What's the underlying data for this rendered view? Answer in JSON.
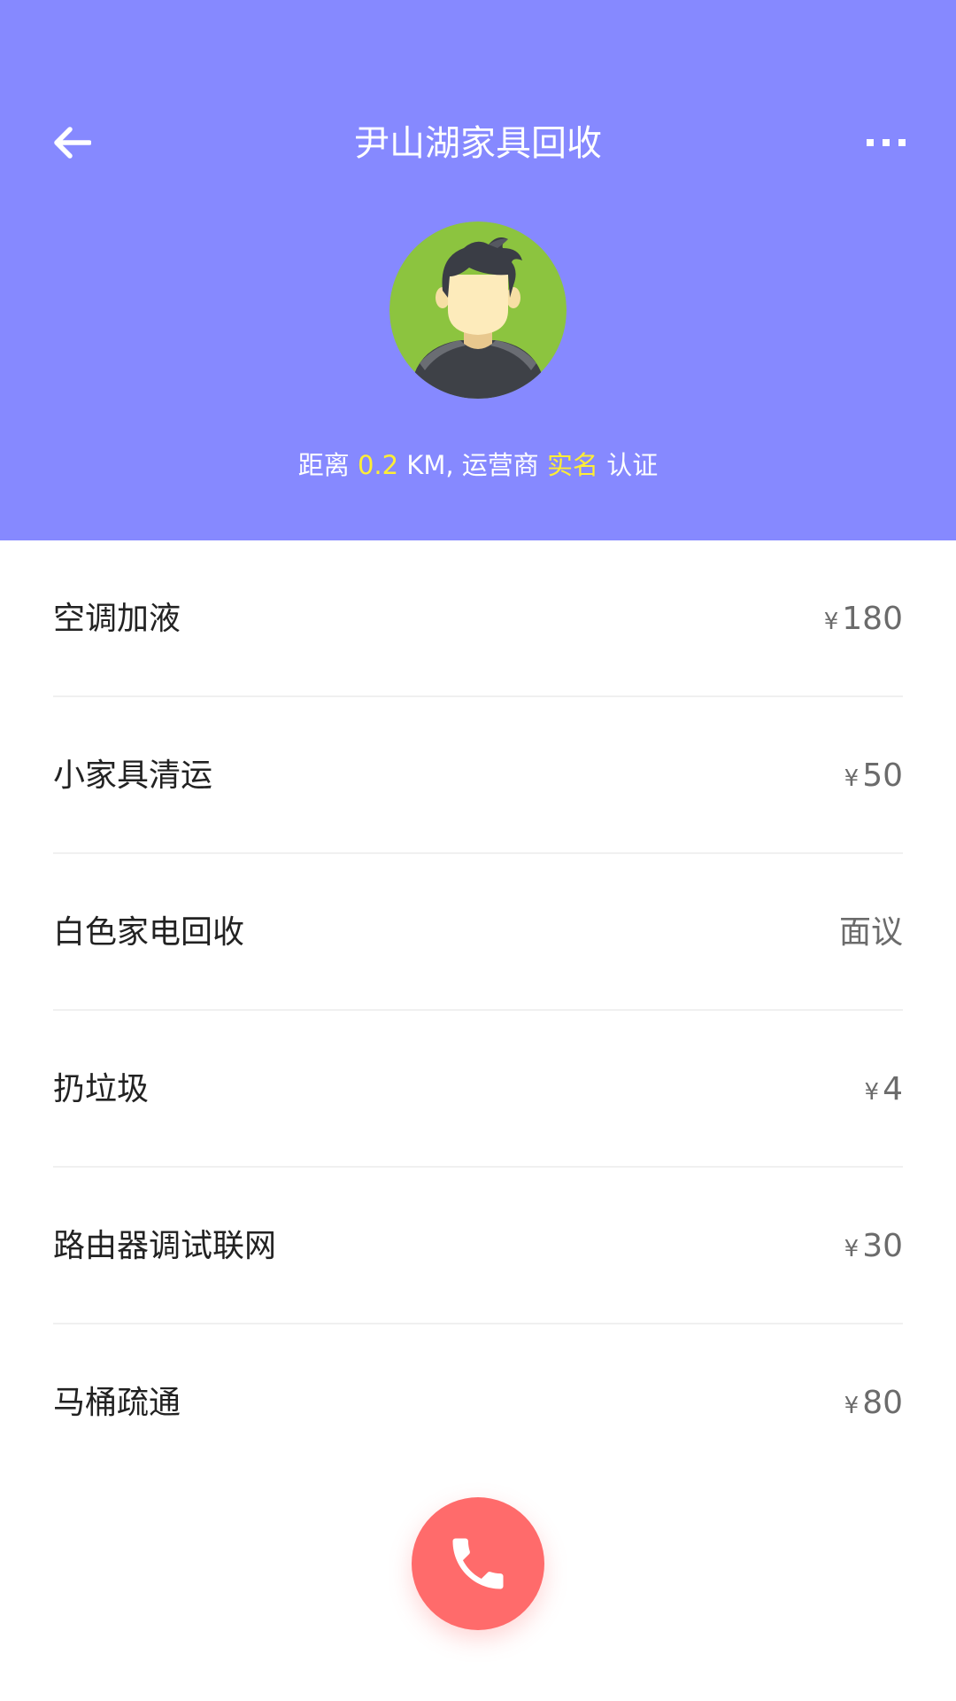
{
  "header": {
    "title": "尹山湖家具回收",
    "back_icon": "arrow-left-icon",
    "more_icon": "more-dots-icon",
    "background_color": "#8689FF"
  },
  "profile": {
    "avatar_icon": "male-avatar-icon",
    "distance_prefix": "距离",
    "distance_value": "0.2",
    "distance_unit": "KM,",
    "operator_label": "运营商",
    "verified_label": "实名",
    "cert_label": "认证",
    "highlight_color": "#FFEE33"
  },
  "services": [
    {
      "name": "空调加液",
      "currency": "¥",
      "price": "180"
    },
    {
      "name": "小家具清运",
      "currency": "¥",
      "price": "50"
    },
    {
      "name": "白色家电回收",
      "currency": "",
      "price": "面议"
    },
    {
      "name": "扔垃圾",
      "currency": "¥",
      "price": "4"
    },
    {
      "name": "路由器调试联网",
      "currency": "¥",
      "price": "30"
    },
    {
      "name": "马桶疏通",
      "currency": "¥",
      "price": "80"
    }
  ],
  "call_button": {
    "icon": "phone-icon",
    "color": "#FF6B6B"
  }
}
